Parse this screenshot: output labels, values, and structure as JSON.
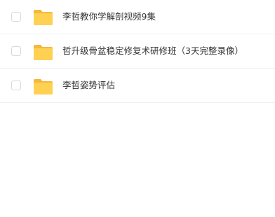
{
  "files": [
    {
      "name": "李哲教你学解剖视频9集",
      "icon": "folder-icon",
      "checked": false
    },
    {
      "name": "哲升级骨盆稳定修复术研修班（3天完整录像）",
      "icon": "folder-icon",
      "checked": false
    },
    {
      "name": "李哲姿势评估",
      "icon": "folder-icon",
      "checked": false
    }
  ],
  "colors": {
    "folder": "#ffd153",
    "folder_back": "#f5b83d",
    "text": "#333333",
    "divider": "#f0f0f0",
    "checkbox_border": "#d9d9d9"
  }
}
